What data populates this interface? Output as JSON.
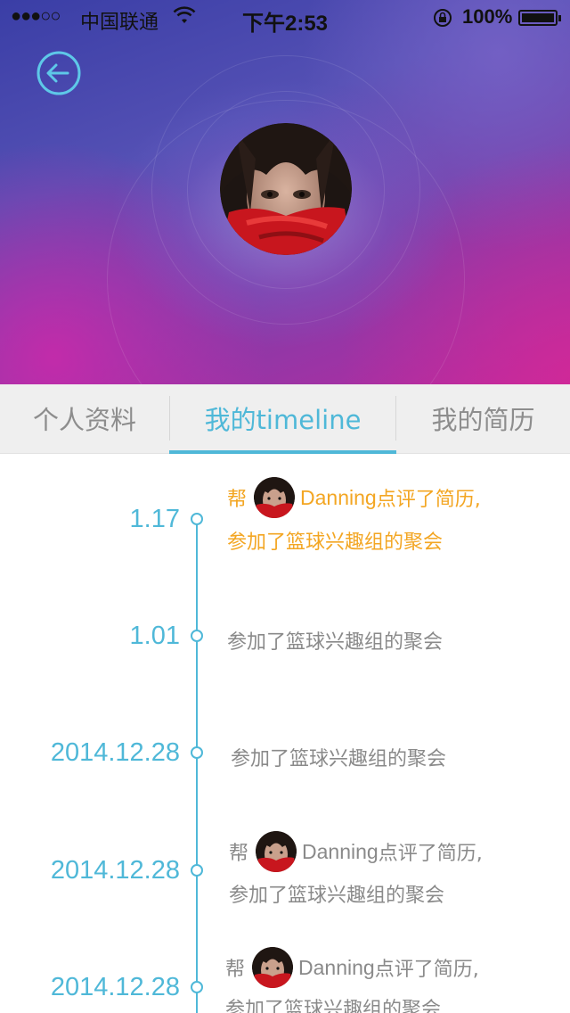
{
  "status_bar": {
    "signal": "●●●○○",
    "carrier": "中国联通",
    "time": "下午2:53",
    "battery": "100%"
  },
  "header": {
    "back_icon": "back-arrow-icon",
    "avatar": "profile-avatar"
  },
  "tabs": [
    {
      "label": "个人资料",
      "active": false
    },
    {
      "label": "我的timeline",
      "active": true
    },
    {
      "label": "我的简历",
      "active": false
    }
  ],
  "timeline": [
    {
      "date": "1.17",
      "prefix": "帮",
      "name": "Danning",
      "suffix": "点评了简历,",
      "line2": "参加了篮球兴趣组的聚会",
      "highlight": true
    },
    {
      "date": "1.01",
      "text": "参加了篮球兴趣组的聚会"
    },
    {
      "date": "2014.12.28",
      "text": "参加了篮球兴趣组的聚会"
    },
    {
      "date": "2014.12.28",
      "prefix": "帮",
      "name": "Danning",
      "suffix": "点评了简历,",
      "line2": "参加了篮球兴趣组的聚会"
    },
    {
      "date": "2014.12.28",
      "prefix": "帮",
      "name": "Danning",
      "suffix": "点评了简历,",
      "line2": "参加了篮球兴趣组的聚会"
    }
  ],
  "colors": {
    "accent": "#4fb8d8",
    "highlight": "#f3a623",
    "muted_text": "#8a8a8a"
  }
}
